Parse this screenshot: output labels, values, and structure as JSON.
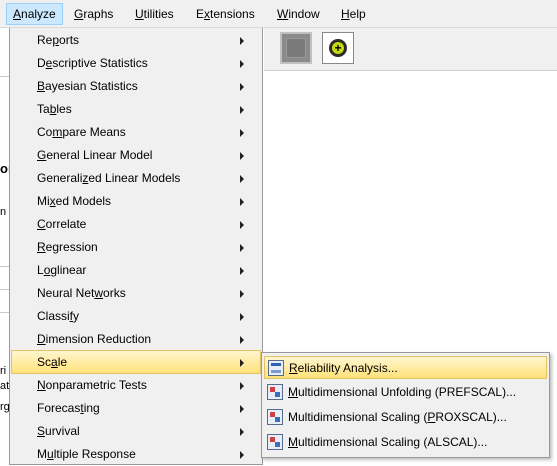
{
  "menubar": {
    "items": [
      {
        "pre": "",
        "key": "A",
        "post": "nalyze"
      },
      {
        "pre": "",
        "key": "G",
        "post": "raphs"
      },
      {
        "pre": "",
        "key": "U",
        "post": "tilities"
      },
      {
        "pre": "E",
        "key": "x",
        "post": "tensions"
      },
      {
        "pre": "",
        "key": "W",
        "post": "indow"
      },
      {
        "pre": "",
        "key": "H",
        "post": "elp"
      }
    ],
    "active_index": 0
  },
  "background": {
    "fragments": [
      "or",
      "n",
      "ri",
      "at",
      "rg"
    ]
  },
  "analyze_menu": {
    "items": [
      {
        "pre": "Re",
        "key": "p",
        "post": "orts"
      },
      {
        "pre": "D",
        "key": "e",
        "post": "scriptive Statistics"
      },
      {
        "pre": "",
        "key": "B",
        "post": "ayesian Statistics"
      },
      {
        "pre": "Ta",
        "key": "b",
        "post": "les"
      },
      {
        "pre": "Co",
        "key": "m",
        "post": "pare Means"
      },
      {
        "pre": "",
        "key": "G",
        "post": "eneral Linear Model"
      },
      {
        "pre": "Generali",
        "key": "z",
        "post": "ed Linear Models"
      },
      {
        "pre": "Mi",
        "key": "x",
        "post": "ed Models"
      },
      {
        "pre": "",
        "key": "C",
        "post": "orrelate"
      },
      {
        "pre": "",
        "key": "R",
        "post": "egression"
      },
      {
        "pre": "L",
        "key": "o",
        "post": "glinear"
      },
      {
        "pre": "Neural Net",
        "key": "w",
        "post": "orks"
      },
      {
        "pre": "Classi",
        "key": "f",
        "post": "y"
      },
      {
        "pre": "",
        "key": "D",
        "post": "imension Reduction"
      },
      {
        "pre": "Sc",
        "key": "a",
        "post": "le"
      },
      {
        "pre": "",
        "key": "N",
        "post": "onparametric Tests"
      },
      {
        "pre": "Forecas",
        "key": "t",
        "post": "ing"
      },
      {
        "pre": "",
        "key": "S",
        "post": "urvival"
      },
      {
        "pre": "M",
        "key": "u",
        "post": "ltiple Response"
      }
    ],
    "highlighted_index": 14
  },
  "scale_submenu": {
    "items": [
      {
        "pre": "",
        "key": "R",
        "post": "eliability Analysis...",
        "icon": "reliability-icon"
      },
      {
        "pre": "",
        "key": "M",
        "post": "ultidimensional Unfolding (PREFSCAL)...",
        "icon": "multidimensional-icon"
      },
      {
        "pre": "Multidimensional Scaling (",
        "key": "P",
        "post": "ROXSCAL)...",
        "icon": "multidimensional-icon"
      },
      {
        "pre": "",
        "key": "M",
        "post": "ultidimensional Scaling (ALSCAL)...",
        "icon": "multidimensional-icon"
      }
    ],
    "highlighted_index": 0
  },
  "colors": {
    "menu_bg": "#f0f0f0",
    "highlight": "#ffe27a",
    "menubar_active": "#cce8ff"
  }
}
